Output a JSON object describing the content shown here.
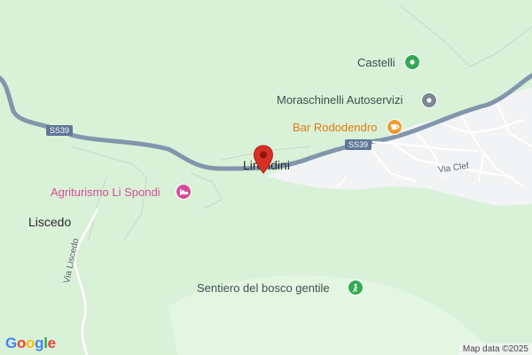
{
  "map": {
    "attribution": "Map data ©2025",
    "logo": [
      "G",
      "o",
      "o",
      "g",
      "l",
      "e"
    ],
    "logo_colors": [
      "#4285F4",
      "#EA4335",
      "#FBBC05",
      "#4285F4",
      "#34A853",
      "#EA4335"
    ],
    "colors": {
      "background": "#d8f1d7",
      "town_area": "#f2f3f5",
      "road_main": "#7f95ad",
      "shield_bg": "#5e7896",
      "marker": "#d93025",
      "poi_generic": "#7a8894",
      "poi_park": "#34a853",
      "poi_food": "#f29b34",
      "poi_lodging": "#d64e9a"
    },
    "places": {
      "liscedo": "Liscedo",
      "lirondini": "Lirondini"
    },
    "pois": {
      "castelli": {
        "name": "Castelli",
        "icon": "pin-icon"
      },
      "moraschinelli": {
        "name": "Moraschinelli Autoservizi",
        "icon": "pin-icon"
      },
      "bar": {
        "name": "Bar Rododendro",
        "icon": "coffee-cup-icon"
      },
      "agriturismo": {
        "name": "Agriturismo Li Spondi",
        "icon": "bed-icon"
      },
      "sentiero": {
        "name": "Sentiero del bosco gentile",
        "icon": "hiker-icon"
      }
    },
    "roads": {
      "ss39_a": "SS39",
      "ss39_b": "SS39",
      "via_clef": "Via Clef",
      "via_liscedo": "Via Liscedo"
    }
  }
}
